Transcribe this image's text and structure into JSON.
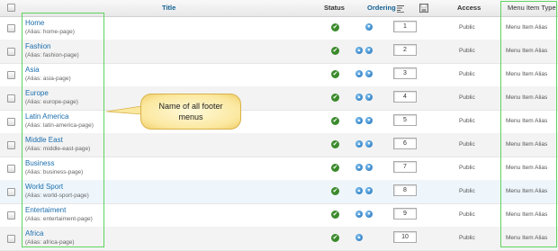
{
  "header": {
    "title": "Title",
    "status": "Status",
    "ordering": "Ordering",
    "access": "Access",
    "menu_item_type": "Menu Item Type"
  },
  "alias_label": "Alias:",
  "rows": [
    {
      "title": "Home",
      "alias": "home-page",
      "order": "1",
      "access": "Public",
      "type": "Menu Item Alias"
    },
    {
      "title": "Fashion",
      "alias": "fashion-page",
      "order": "2",
      "access": "Public",
      "type": "Menu Item Alias"
    },
    {
      "title": "Asia",
      "alias": "asia-page",
      "order": "3",
      "access": "Public",
      "type": "Menu Item Alias"
    },
    {
      "title": "Europe",
      "alias": "europe-page",
      "order": "4",
      "access": "Public",
      "type": "Menu Item Alias"
    },
    {
      "title": "Latin America",
      "alias": "latin-america-page",
      "order": "5",
      "access": "Public",
      "type": "Menu Item Alias"
    },
    {
      "title": "Middle East",
      "alias": "middle-east-page",
      "order": "6",
      "access": "Public",
      "type": "Menu Item Alias"
    },
    {
      "title": "Business",
      "alias": "business-page",
      "order": "7",
      "access": "Public",
      "type": "Menu Item Alias"
    },
    {
      "title": "World Sport",
      "alias": "world-sport-page",
      "order": "8",
      "access": "Public",
      "type": "Menu Item Alias"
    },
    {
      "title": "Entertaiment",
      "alias": "entertaiment-page",
      "order": "9",
      "access": "Public",
      "type": "Menu Item Alias"
    },
    {
      "title": "Africa",
      "alias": "africa-page",
      "order": "10",
      "access": "Public",
      "type": "Menu Item Alias"
    }
  ],
  "callout": {
    "text_line1": "Name of all footer",
    "text_line2": "menus"
  },
  "colors": {
    "highlight_box": "#5fd35f",
    "link": "#1b6eae",
    "status_ok": "#3b8a2c"
  }
}
